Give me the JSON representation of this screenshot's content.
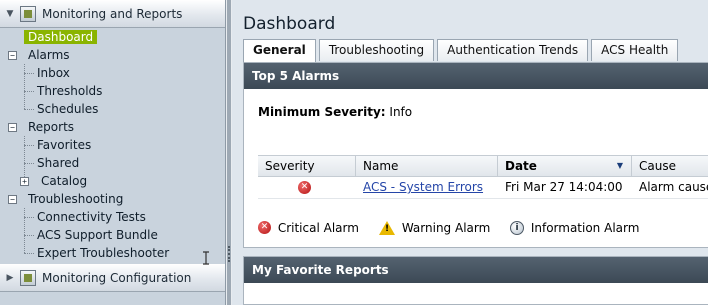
{
  "nav": {
    "monitoring_title": "Monitoring and Reports",
    "config_title": "Monitoring Configuration",
    "dashboard": "Dashboard",
    "alarms": {
      "label": "Alarms",
      "items": [
        "Inbox",
        "Thresholds",
        "Schedules"
      ]
    },
    "reports": {
      "label": "Reports",
      "items": [
        "Favorites",
        "Shared",
        "Catalog"
      ]
    },
    "troubleshooting": {
      "label": "Troubleshooting",
      "items": [
        "Connectivity Tests",
        "ACS Support Bundle",
        "Expert Troubleshooter"
      ]
    },
    "selected_color": "#8ab400"
  },
  "main": {
    "title": "Dashboard",
    "tabs": [
      "General",
      "Troubleshooting",
      "Authentication Trends",
      "ACS Health"
    ],
    "active_tab": "General",
    "alarms_panel": {
      "title": "Top 5 Alarms",
      "severity_label": "Minimum Severity:",
      "severity_value": "Info",
      "columns": [
        "Severity",
        "Name",
        "Date",
        "Cause"
      ],
      "rows": [
        {
          "severity": "critical",
          "name": "ACS - System Errors",
          "date": "Fri Mar 27 14:04:00",
          "cause": "Alarm cause"
        }
      ]
    },
    "legend": {
      "critical": "Critical Alarm",
      "warning": "Warning Alarm",
      "information": "Information Alarm"
    },
    "favorites_panel": {
      "title": "My Favorite Reports"
    }
  }
}
